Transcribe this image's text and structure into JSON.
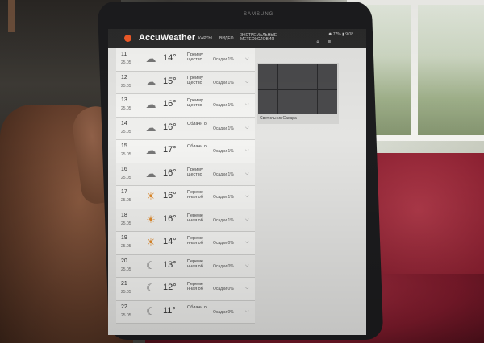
{
  "app": {
    "name": "AccuWeather",
    "nav": [
      "КАРТЫ",
      "ВИДЕО",
      "ЭКСТРЕМАЛЬНЫЕ МЕТЕОУСЛОВИЯ"
    ],
    "status": "✹ 77% ▮ 9:08",
    "device_brand": "SAMSUNG"
  },
  "hourly": [
    {
      "hour": "11",
      "date": "25.05",
      "temp": "14°",
      "desc": "Преиму щество",
      "precip": "Осадки 1%",
      "icon": "cloudy-icon"
    },
    {
      "hour": "12",
      "date": "25.05",
      "temp": "15°",
      "desc": "Преиму щество",
      "precip": "Осадки 1%",
      "icon": "cloudy-icon"
    },
    {
      "hour": "13",
      "date": "25.05",
      "temp": "16°",
      "desc": "Преиму щество",
      "precip": "Осадки 1%",
      "icon": "cloudy-icon"
    },
    {
      "hour": "14",
      "date": "25.05",
      "temp": "16°",
      "desc": "Облачн о",
      "precip": "Осадки 1%",
      "icon": "cloud-icon"
    },
    {
      "hour": "15",
      "date": "25.05",
      "temp": "17°",
      "desc": "Облачн о",
      "precip": "Осадки 1%",
      "icon": "cloud-icon"
    },
    {
      "hour": "16",
      "date": "25.05",
      "temp": "16°",
      "desc": "Преиму щество",
      "precip": "Осадки 1%",
      "icon": "cloudy-icon"
    },
    {
      "hour": "17",
      "date": "25.05",
      "temp": "16°",
      "desc": "Переме нная об",
      "precip": "Осадки 1%",
      "icon": "sun-cloud-icon"
    },
    {
      "hour": "18",
      "date": "25.05",
      "temp": "16°",
      "desc": "Переме нная об",
      "precip": "Осадки 1%",
      "icon": "sun-cloud-icon"
    },
    {
      "hour": "19",
      "date": "25.05",
      "temp": "14°",
      "desc": "Переме нная об",
      "precip": "Осадки 0%",
      "icon": "sun-cloud-icon"
    },
    {
      "hour": "20",
      "date": "25.05",
      "temp": "13°",
      "desc": "Переме нная об",
      "precip": "Осадки 0%",
      "icon": "moon-icon"
    },
    {
      "hour": "21",
      "date": "25.05",
      "temp": "12°",
      "desc": "Переме нная об",
      "precip": "Осадки 0%",
      "icon": "moon-cloud-icon"
    },
    {
      "hour": "22",
      "date": "25.05",
      "temp": "11°",
      "desc": "Облачн о",
      "precip": "Осадки 0%",
      "icon": "moon-cloud-icon"
    }
  ],
  "ad": {
    "caption": "Светильник Сахара"
  },
  "colors": {
    "accent": "#f05a28",
    "appbar": "#2b2b2b",
    "blanket": "#8a1f30"
  }
}
